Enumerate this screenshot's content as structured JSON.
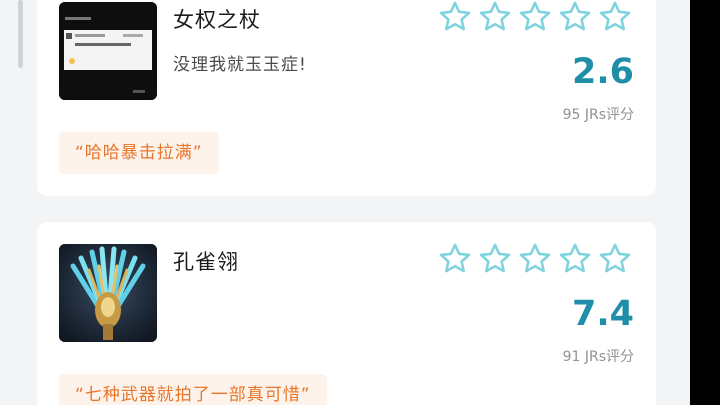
{
  "items": [
    {
      "title": "女权之杖",
      "comment": "没理我就玉玉症!",
      "stars_filled": 0,
      "stars_total": 5,
      "score": "2.6",
      "rating_count": "95 JRs评分",
      "quote": "“哈哈暴击拉满”",
      "thumbnail": "screenshot-thumbnail"
    },
    {
      "title": "孔雀翎",
      "stars_filled": 0,
      "stars_total": 5,
      "score": "7.4",
      "rating_count": "91 JRs评分",
      "quote": "“七种武器就拍了一部真可惜”",
      "thumbnail": "peacock-feather-weapon-thumbnail"
    }
  ],
  "colors": {
    "score": "#1f8ea8",
    "star_outline": "#7fd3de",
    "quote_text": "#e8752c",
    "quote_bg": "#fdf3ea"
  }
}
